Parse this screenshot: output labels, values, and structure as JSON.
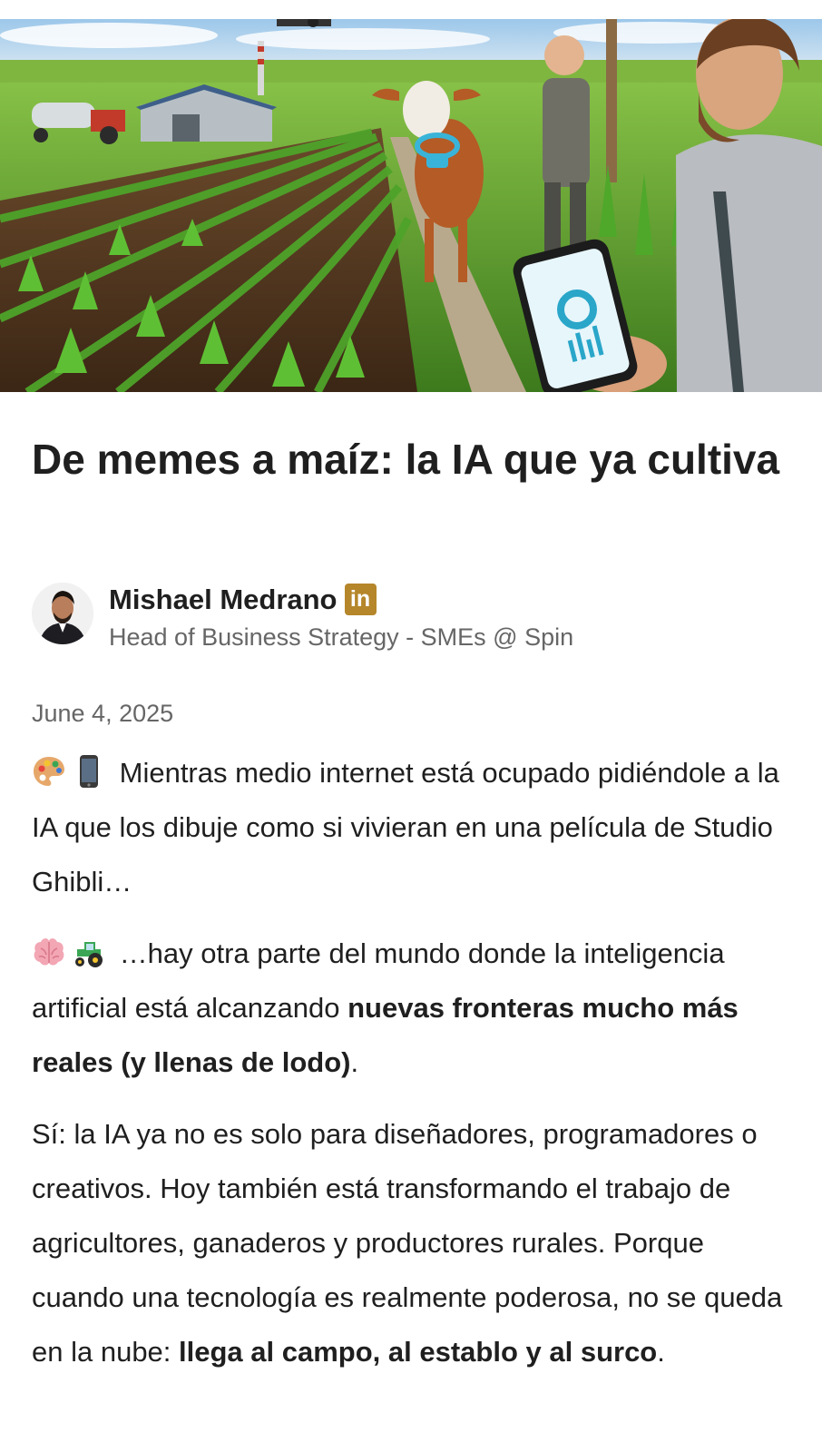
{
  "article": {
    "title": "De memes a maíz: la IA que ya cultiva",
    "author": {
      "name": "Mishael Medrano",
      "linkedin_badge": "in",
      "headline": "Head of Business Strategy - SMEs @ Spin"
    },
    "date": "June 4, 2025",
    "paragraph1": {
      "icons": [
        "palette-icon",
        "mobile-phone-icon"
      ],
      "text": "Mientras medio internet está ocupado pidiéndole a la IA que los dibuje como si vivieran en una película de Studio Ghibli…"
    },
    "paragraph2": {
      "icons": [
        "brain-icon",
        "tractor-icon"
      ],
      "text": "…hay otra parte del mundo donde la inteligencia artificial está alcanzando ",
      "bold": "nuevas fronteras mucho más reales (y llenas de lodo)",
      "end": "."
    },
    "paragraph3": {
      "text": "Sí: la IA ya no es solo para diseñadores, programadores o creativos. Hoy también está transformando el trabajo de agricultores, ganaderos y productores rurales. Porque cuando una tecnología es realmente poderosa, no se queda en la nube: ",
      "bold": "llega al campo, al establo y al surco",
      "end": "."
    }
  },
  "colors": {
    "text": "#1f1f1f",
    "secondary_text": "#666666",
    "linkedin_badge": "#b5862a"
  }
}
